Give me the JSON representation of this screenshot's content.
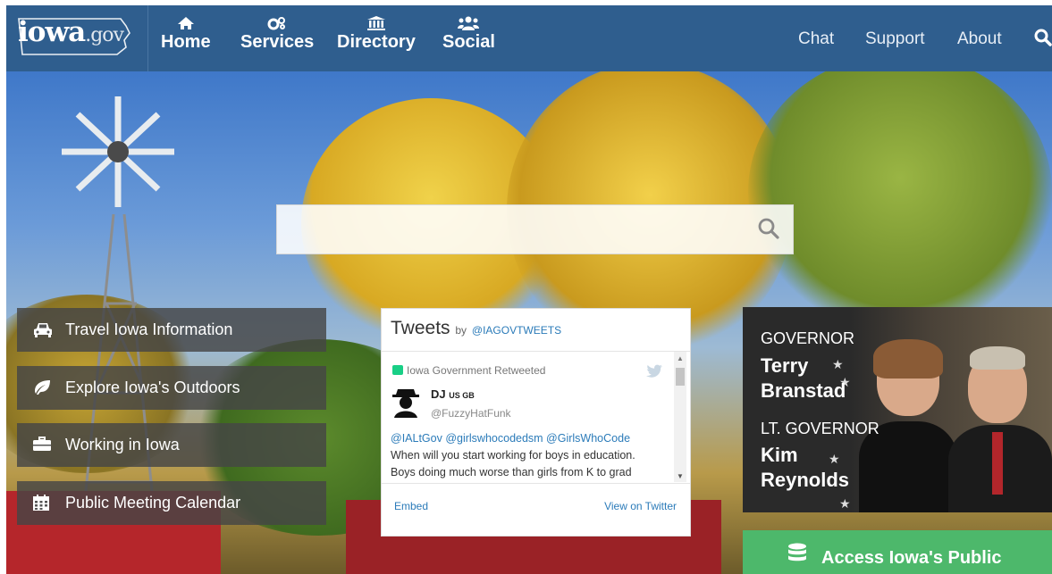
{
  "header": {
    "logo": {
      "main": "iowa",
      "suffix": ".gov"
    },
    "nav": [
      {
        "label": "Home",
        "icon": "home-icon"
      },
      {
        "label": "Services",
        "icon": "gears-icon"
      },
      {
        "label": "Directory",
        "icon": "building-icon"
      },
      {
        "label": "Social",
        "icon": "users-icon"
      }
    ],
    "right_links": [
      "Chat",
      "Support",
      "About"
    ],
    "colors": {
      "bar": "#2f5e8e"
    }
  },
  "search": {
    "placeholder": "",
    "value": ""
  },
  "tiles": [
    {
      "label": "Travel Iowa Information",
      "icon": "car-icon"
    },
    {
      "label": "Explore Iowa's Outdoors",
      "icon": "leaf-icon"
    },
    {
      "label": "Working in Iowa",
      "icon": "briefcase-icon"
    },
    {
      "label": "Public Meeting Calendar",
      "icon": "calendar-icon"
    }
  ],
  "tweets": {
    "title": "Tweets",
    "by": "by",
    "handle": "@IAGOVTWEETS",
    "retweeted_by": "Iowa Government Retweeted",
    "author_name": "DJ",
    "author_flags": "US GB",
    "author_handle": "@FuzzyHatFunk",
    "mentions": "@IALtGov @girlswhocodedsm @GirlsWhoCode",
    "text_line1": "When will you start working for boys in education.",
    "text_line2": "Boys doing much worse than girls from K to grad",
    "embed_label": "Embed",
    "view_label": "View on Twitter"
  },
  "officials": {
    "governor_title": "GOVERNOR",
    "governor_first": "Terry",
    "governor_last": "Branstad",
    "lt_title": "LT. GOVERNOR",
    "lt_first": "Kim",
    "lt_last": "Reynolds"
  },
  "access": {
    "label": "Access Iowa's Public",
    "icon": "database-icon",
    "color": "#4db86b"
  }
}
